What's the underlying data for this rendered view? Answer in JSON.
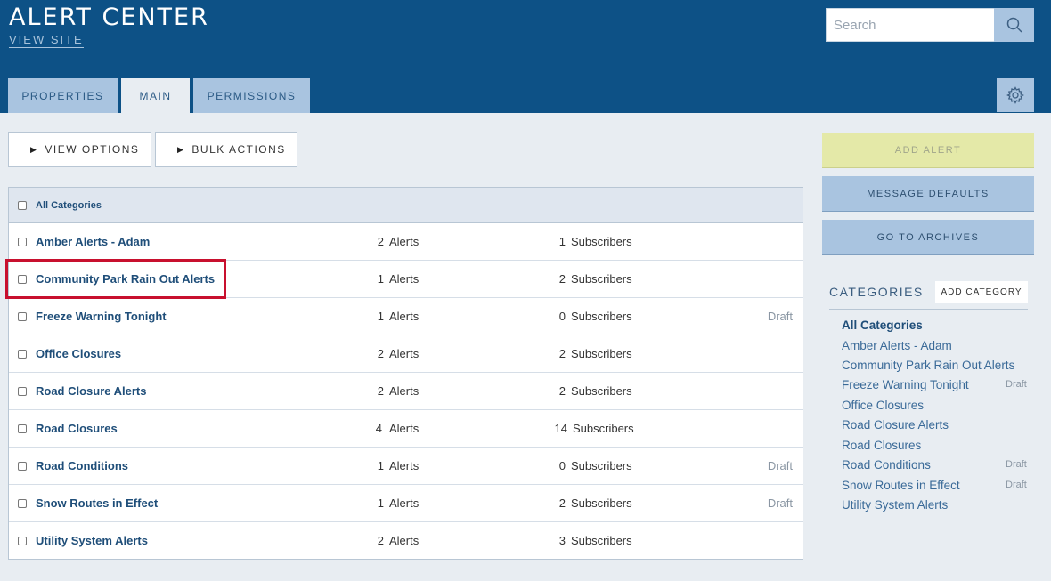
{
  "app": {
    "title": "ALERT CENTER",
    "view_site": "VIEW SITE",
    "search_placeholder": "Search"
  },
  "tabs": [
    {
      "label": "PROPERTIES",
      "active": false
    },
    {
      "label": "MAIN",
      "active": true
    },
    {
      "label": "PERMISSIONS",
      "active": false
    }
  ],
  "toolbar": {
    "view_options": "VIEW OPTIONS",
    "bulk_actions": "BULK ACTIONS"
  },
  "table": {
    "header": "All Categories",
    "rows": [
      {
        "name": "Amber Alerts - Adam",
        "alerts": "2",
        "alerts_label": "Alerts",
        "subscribers": "1",
        "subscribers_label": "Subscribers",
        "status": ""
      },
      {
        "name": "Community Park Rain Out Alerts",
        "alerts": "1",
        "alerts_label": "Alerts",
        "subscribers": "2",
        "subscribers_label": "Subscribers",
        "status": ""
      },
      {
        "name": "Freeze Warning Tonight",
        "alerts": "1",
        "alerts_label": "Alerts",
        "subscribers": "0",
        "subscribers_label": "Subscribers",
        "status": "Draft"
      },
      {
        "name": "Office Closures",
        "alerts": "2",
        "alerts_label": "Alerts",
        "subscribers": "2",
        "subscribers_label": "Subscribers",
        "status": ""
      },
      {
        "name": "Road Closure Alerts",
        "alerts": "2",
        "alerts_label": "Alerts",
        "subscribers": "2",
        "subscribers_label": "Subscribers",
        "status": ""
      },
      {
        "name": "Road Closures",
        "alerts": "4",
        "alerts_label": "Alerts",
        "subscribers": "14",
        "subscribers_label": "Subscribers",
        "status": ""
      },
      {
        "name": "Road Conditions",
        "alerts": "1",
        "alerts_label": "Alerts",
        "subscribers": "0",
        "subscribers_label": "Subscribers",
        "status": "Draft"
      },
      {
        "name": "Snow Routes in Effect",
        "alerts": "1",
        "alerts_label": "Alerts",
        "subscribers": "2",
        "subscribers_label": "Subscribers",
        "status": "Draft"
      },
      {
        "name": "Utility System Alerts",
        "alerts": "2",
        "alerts_label": "Alerts",
        "subscribers": "3",
        "subscribers_label": "Subscribers",
        "status": ""
      }
    ]
  },
  "sidebar": {
    "add_alert": "ADD ALERT",
    "message_defaults": "MESSAGE DEFAULTS",
    "go_to_archives": "GO TO ARCHIVES",
    "categories_title": "CATEGORIES",
    "add_category": "ADD CATEGORY",
    "categories": [
      {
        "label": "All Categories",
        "status": ""
      },
      {
        "label": "Amber Alerts - Adam",
        "status": ""
      },
      {
        "label": "Community Park Rain Out Alerts",
        "status": ""
      },
      {
        "label": "Freeze Warning Tonight",
        "status": "Draft"
      },
      {
        "label": "Office Closures",
        "status": ""
      },
      {
        "label": "Road Closure Alerts",
        "status": ""
      },
      {
        "label": "Road Closures",
        "status": ""
      },
      {
        "label": "Road Conditions",
        "status": "Draft"
      },
      {
        "label": "Snow Routes in Effect",
        "status": "Draft"
      },
      {
        "label": "Utility System Alerts",
        "status": ""
      }
    ]
  },
  "icons": {
    "search": "search-icon",
    "gear": "gear-icon",
    "triangle": "play-triangle-icon"
  },
  "colors": {
    "header": "#0d5186",
    "tab": "#a9c4e0",
    "add_alert": "#e4e9a8",
    "highlight": "#c8102e"
  }
}
